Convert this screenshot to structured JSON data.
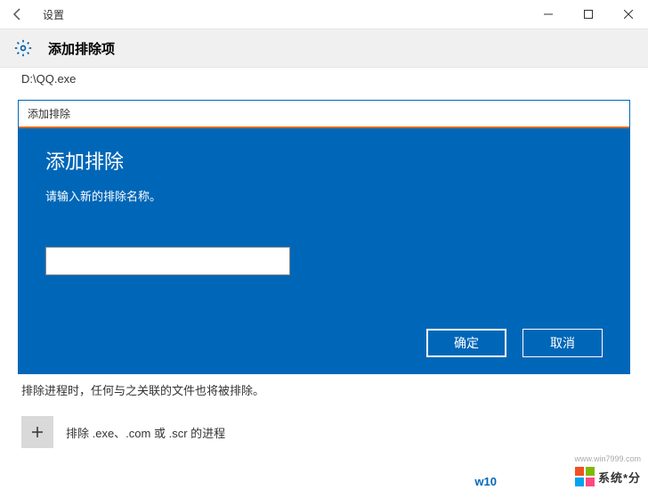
{
  "window": {
    "title": "设置"
  },
  "header": {
    "title": "添加排除项"
  },
  "content": {
    "path_text": "D:\\QQ.exe",
    "bottom_text": "排除进程时，任何与之关联的文件也将被排除。",
    "exclude_label": "排除 .exe、.com 或 .scr 的进程"
  },
  "dialog": {
    "titlebar": "添加排除",
    "heading": "添加排除",
    "subtext": "请输入新的排除名称。",
    "input_value": "",
    "ok_label": "确定",
    "cancel_label": "取消"
  },
  "watermark": {
    "text": "系统*分",
    "url_fragment": "w10",
    "source": "www.win7999.com",
    "colors": [
      "#f25022",
      "#7fba00",
      "#00a4ef",
      "#ff4981"
    ]
  }
}
